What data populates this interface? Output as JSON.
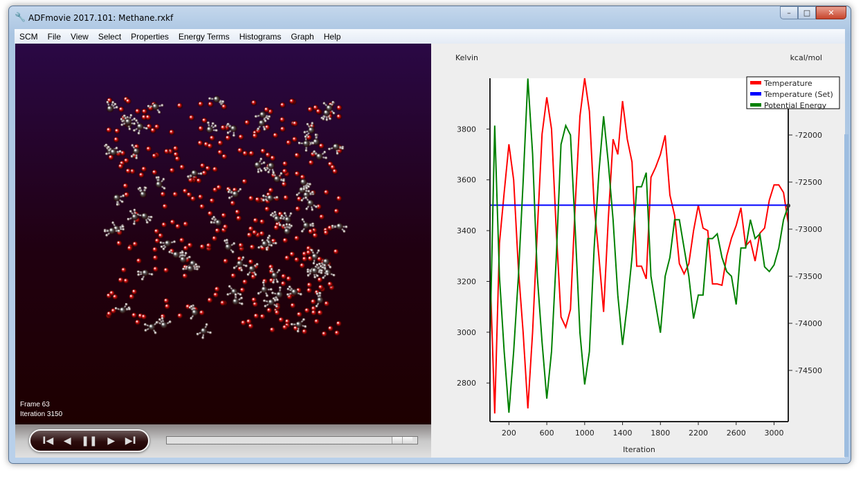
{
  "window": {
    "title": "ADFmovie 2017.101: Methane.rxkf",
    "app_icon": "wrench-magnifier-icon",
    "controls": [
      "minimize",
      "maximize",
      "close"
    ]
  },
  "menu": [
    "SCM",
    "File",
    "View",
    "Select",
    "Properties",
    "Energy Terms",
    "Histograms",
    "Graph",
    "Help"
  ],
  "viewer": {
    "frame_label": "Frame 63",
    "iteration_label": "Iteration 3150",
    "atom_colors": {
      "oxygen": "#e01010",
      "carbon": "#555555",
      "hydrogen": "#eeeeee"
    }
  },
  "player": {
    "buttons": [
      "first-frame",
      "previous-frame",
      "pause",
      "next-frame",
      "last-frame"
    ],
    "glyphs": [
      "I◀",
      "◀",
      "❚❚",
      "▶",
      "▶I"
    ],
    "position": 0.98
  },
  "chart_data": {
    "type": "line",
    "xlabel": "Iteration",
    "ylabel_left": "Kelvin",
    "ylabel_right": "kcal/mol",
    "xlim": [
      0,
      3150
    ],
    "ylim_left": [
      2648,
      4000
    ],
    "ylim_right": [
      -75044,
      -71397
    ],
    "xticks": [
      200,
      600,
      1000,
      1400,
      1800,
      2200,
      2600,
      3000
    ],
    "yticks_left": [
      2800,
      3000,
      3200,
      3400,
      3600,
      3800
    ],
    "yticks_right": [
      -74500,
      -74000,
      -73500,
      -73000,
      -72500,
      -72000
    ],
    "grid": false,
    "legend": "top-right",
    "x": [
      0,
      50,
      100,
      150,
      200,
      250,
      300,
      350,
      400,
      450,
      500,
      550,
      600,
      650,
      700,
      750,
      800,
      850,
      900,
      950,
      1000,
      1050,
      1100,
      1150,
      1200,
      1250,
      1300,
      1350,
      1400,
      1450,
      1500,
      1550,
      1600,
      1650,
      1700,
      1750,
      1800,
      1850,
      1900,
      1950,
      2000,
      2050,
      2100,
      2150,
      2200,
      2250,
      2300,
      2350,
      2400,
      2450,
      2500,
      2550,
      2600,
      2650,
      2700,
      2750,
      2800,
      2850,
      2900,
      2950,
      3000,
      3050,
      3100,
      3150
    ],
    "series": [
      {
        "name": "Temperature",
        "axis": "left",
        "color": "#ff0000",
        "values": [
          3250,
          2680,
          3350,
          3550,
          3740,
          3600,
          3250,
          3000,
          2700,
          3000,
          3400,
          3780,
          3925,
          3800,
          3400,
          3060,
          3020,
          3090,
          3500,
          3850,
          4000,
          3870,
          3500,
          3300,
          3080,
          3450,
          3760,
          3700,
          3910,
          3760,
          3670,
          3260,
          3260,
          3210,
          3610,
          3650,
          3700,
          3775,
          3540,
          3460,
          3270,
          3230,
          3270,
          3400,
          3500,
          3410,
          3400,
          3190,
          3190,
          3185,
          3300,
          3370,
          3420,
          3490,
          3340,
          3360,
          3280,
          3390,
          3410,
          3520,
          3580,
          3580,
          3550,
          3430
        ]
      },
      {
        "name": "Temperature (Set)",
        "axis": "left",
        "color": "#0000ff",
        "values": [
          3500,
          3500,
          3500,
          3500,
          3500,
          3500,
          3500,
          3500,
          3500,
          3500,
          3500,
          3500,
          3500,
          3500,
          3500,
          3500,
          3500,
          3500,
          3500,
          3500,
          3500,
          3500,
          3500,
          3500,
          3500,
          3500,
          3500,
          3500,
          3500,
          3500,
          3500,
          3500,
          3500,
          3500,
          3500,
          3500,
          3500,
          3500,
          3500,
          3500,
          3500,
          3500,
          3500,
          3500,
          3500,
          3500,
          3500,
          3500,
          3500,
          3500,
          3500,
          3500,
          3500,
          3500,
          3500,
          3500,
          3500,
          3500,
          3500,
          3500,
          3500,
          3500,
          3500,
          3500
        ]
      },
      {
        "name": "Potential Energy",
        "axis": "right",
        "color": "#008000",
        "values": [
          -74200,
          -71900,
          -73500,
          -74300,
          -74950,
          -74300,
          -73500,
          -72500,
          -71400,
          -72200,
          -73500,
          -74200,
          -74800,
          -74300,
          -73300,
          -72100,
          -71900,
          -72000,
          -73000,
          -74100,
          -74650,
          -74300,
          -73200,
          -72400,
          -71800,
          -72300,
          -72900,
          -73700,
          -74230,
          -73800,
          -73300,
          -72550,
          -72550,
          -72400,
          -73500,
          -73800,
          -74100,
          -73500,
          -73300,
          -72900,
          -72900,
          -73200,
          -73500,
          -73950,
          -73700,
          -73700,
          -73100,
          -73100,
          -73050,
          -73300,
          -73450,
          -73500,
          -73800,
          -73200,
          -73200,
          -72900,
          -73100,
          -73050,
          -73400,
          -73450,
          -73380,
          -73200,
          -72900,
          -72750
        ]
      }
    ]
  }
}
